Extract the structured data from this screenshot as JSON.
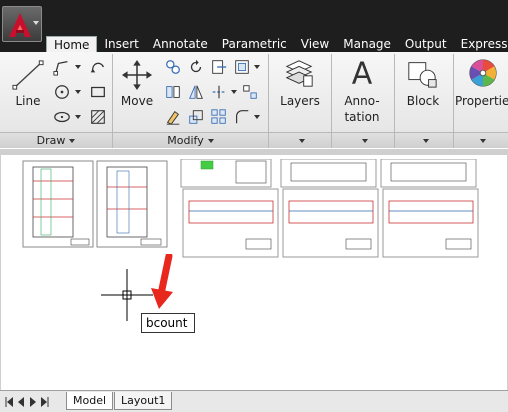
{
  "ribbon_tabs": [
    "Home",
    "Insert",
    "Annotate",
    "Parametric",
    "View",
    "Manage",
    "Output",
    "Express"
  ],
  "active_tab": "Home",
  "panels": {
    "draw": {
      "title": "Draw",
      "line_label": "Line"
    },
    "modify": {
      "title": "Modify",
      "move_label": "Move"
    },
    "layers": {
      "label": "Layers"
    },
    "annotation": {
      "label_line1": "Anno-",
      "label_line2": "tation"
    },
    "block": {
      "label": "Block"
    },
    "properties": {
      "label": "Properties"
    }
  },
  "command_input": {
    "value": "bcount"
  },
  "layout_tabs": [
    "Model",
    "Layout1"
  ],
  "active_layout": "Model",
  "colors": {
    "tabbar_bg": "#1e1e1e",
    "ribbon_bg": "#ececec",
    "logo_red": "#c8102e",
    "arrow_red": "#e8271d"
  },
  "icons": {
    "app_logo": "autocad-logo-icon",
    "line": "line-icon",
    "polyline": "polyline-icon",
    "circle": "circle-icon",
    "arc": "arc-icon",
    "rectangle": "rectangle-icon",
    "hatch": "hatch-icon",
    "move": "move-icon",
    "layers": "layers-icon",
    "annotation": "annotation-icon",
    "block": "block-icon",
    "properties": "properties-icon",
    "pointer": "red-arrow-pointer-icon"
  }
}
